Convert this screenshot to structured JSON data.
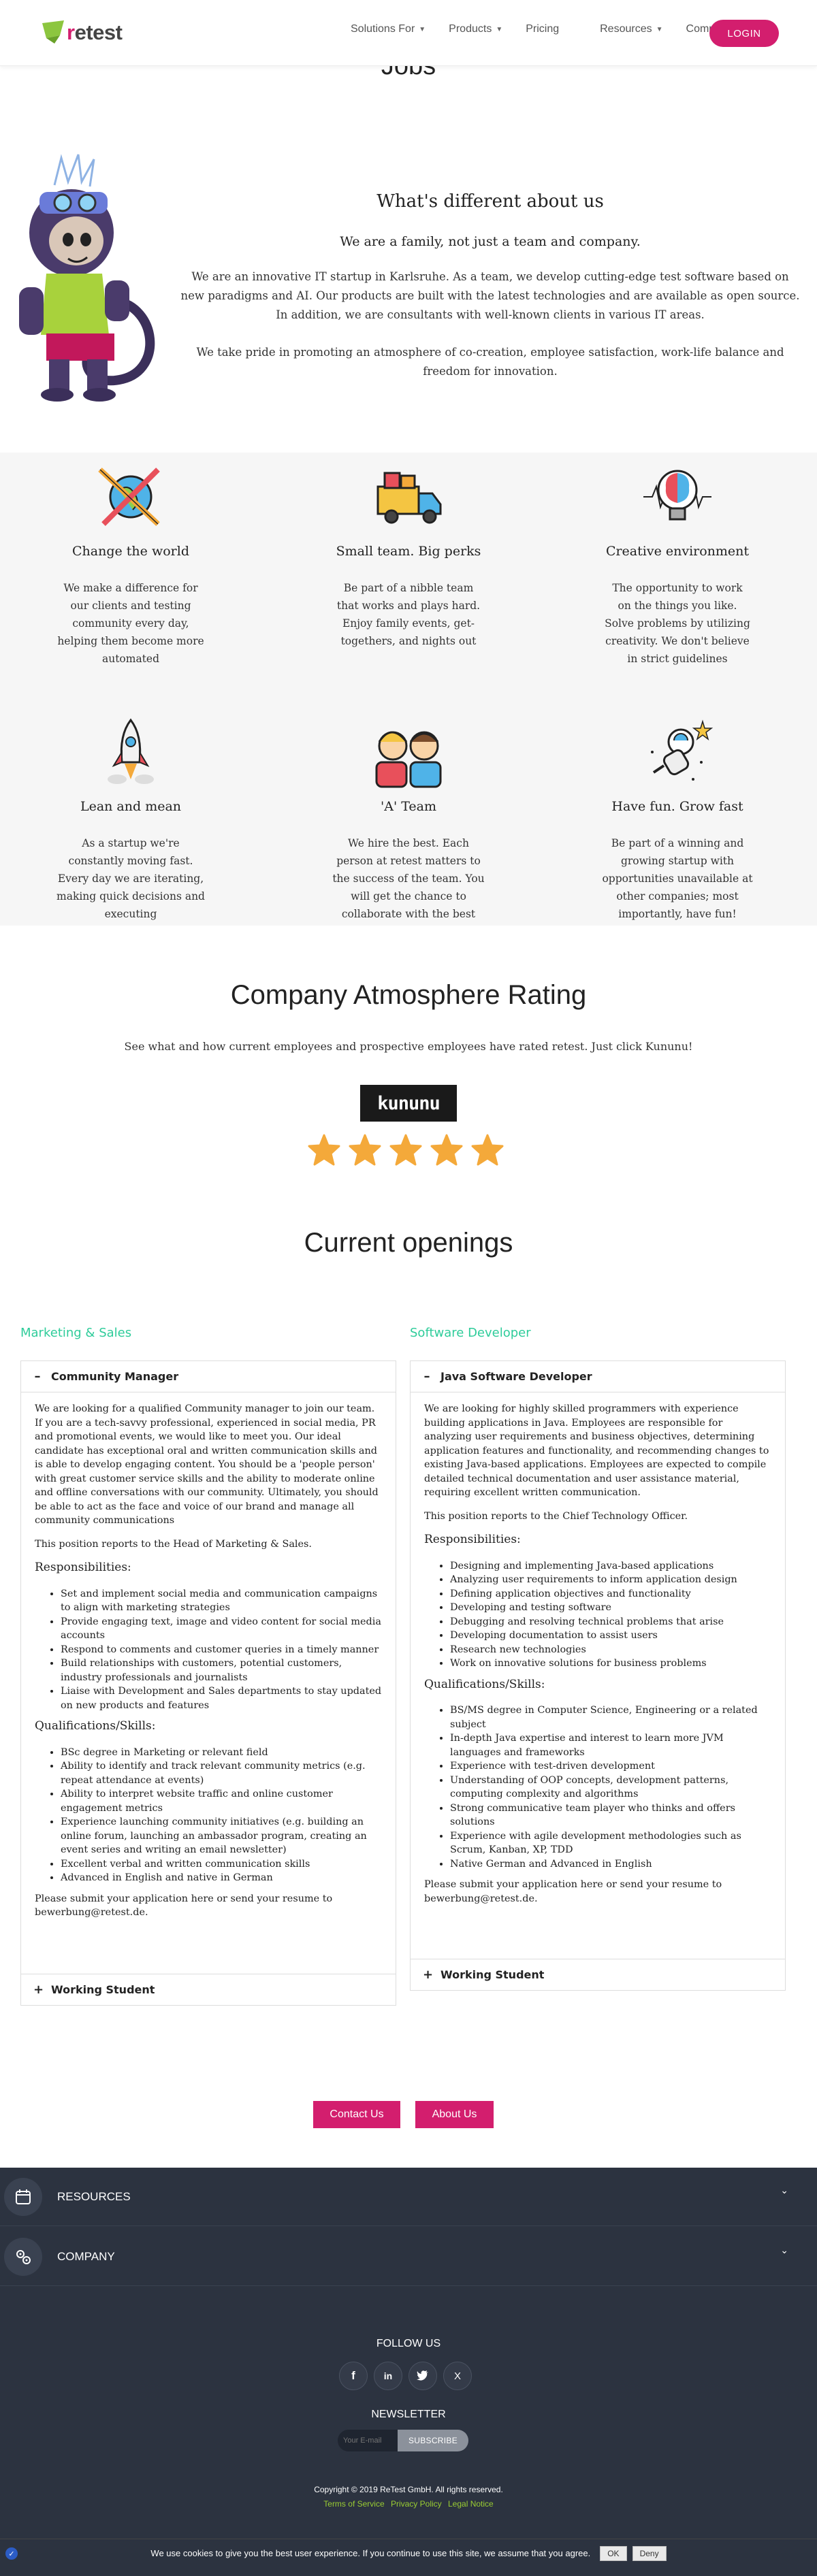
{
  "header": {
    "logo_text_r": "r",
    "logo_text_rest": "etest",
    "nav": [
      {
        "label": "Solutions For",
        "dropdown": true
      },
      {
        "label": "Products",
        "dropdown": true
      },
      {
        "label": "Pricing",
        "dropdown": false
      },
      {
        "label": "Resources",
        "dropdown": true
      },
      {
        "label": "Company",
        "dropdown": true
      }
    ],
    "login_label": "LOGIN"
  },
  "intro": {
    "jobs_title": "Jobs",
    "about_heading": "What's different about us",
    "about_sub": "We are a family, not just a team and company.",
    "about_p1": "We are an innovative IT startup in Karlsruhe. As a team, we develop cutting-edge test software based on new paradigms and AI. Our products are built with the latest technologies and are available as open source. In addition, we are consultants with well-known clients in various IT areas.",
    "about_p2": "We take pride in promoting an atmosphere of co-creation, employee satisfaction, work-life balance and freedom for innovation."
  },
  "features": [
    {
      "icon": "globe-pencils-icon",
      "title": "Change the world",
      "text": "We make a difference for our clients and testing community every day, helping them become more automated"
    },
    {
      "icon": "truck-icon",
      "title": "Small team. Big perks",
      "text": "Be part of a nibble team that works and plays hard. Enjoy family events, get-togethers, and nights out"
    },
    {
      "icon": "lightbulb-brain-icon",
      "title": "Creative environment",
      "text": "The opportunity to work on the things you like. Solve problems by utilizing creativity. We don't believe in strict guidelines"
    },
    {
      "icon": "rocket-icon",
      "title": "Lean and mean",
      "text": "As a startup we're constantly moving fast. Every day we are iterating, making quick decisions and executing"
    },
    {
      "icon": "team-people-icon",
      "title": "'A' Team",
      "text": "We hire the best. Each person at retest matters to the success of the team. You will get the chance to collaborate with the best"
    },
    {
      "icon": "astronaut-icon",
      "title": "Have fun. Grow fast",
      "text": "Be part of a winning and growing startup with opportunities unavailable at other companies; most importantly, have fun!"
    }
  ],
  "rating": {
    "heading": "Company Atmosphere Rating",
    "text": "See what and how current employees and prospective employees have rated retest. Just click Kununu!",
    "kununu_label": "kununu",
    "stars": 5,
    "star_color": "#f4a93a"
  },
  "openings": {
    "heading": "Current openings",
    "columns": [
      {
        "title": "Marketing & Sales",
        "open_job": {
          "title": "Community Manager",
          "intro": "We are looking for a qualified Community manager to join our team. If you are a tech-savvy professional, experienced in social media, PR and promotional events, we would like to meet you. Our ideal candidate has exceptional oral and written communication skills and is able to develop engaging content. You should be a 'people person' with great customer service skills and the ability to moderate online and offline conversations with our community. Ultimately, you should be able to act as the face and voice of our brand and manage all community communications",
          "reports": "This position reports to the Head of Marketing & Sales.",
          "resp_heading": "Responsibilities:",
          "responsibilities": [
            "Set and implement social media and communication campaigns to align with marketing strategies",
            "Provide engaging text, image and video content for social media accounts",
            "Respond to comments and customer queries in a timely manner",
            "Build relationships with customers, potential customers, industry professionals and journalists",
            "Liaise with Development and Sales departments to stay updated on new products and features"
          ],
          "qual_heading": "Qualifications/Skills:",
          "qualifications": [
            "BSc degree in Marketing or relevant field",
            "Ability to identify and track relevant community metrics (e.g. repeat attendance at events)",
            "Ability to interpret website traffic and online customer engagement metrics",
            "Experience launching community initiatives (e.g. building an online forum, launching an ambassador program, creating an event series and writing an email newsletter)",
            "Excellent verbal and written communication skills",
            "Advanced in English and native in German"
          ],
          "apply": "Please submit your application here or send your resume to bewerbung@retest.de."
        },
        "closed_job": "Working Student"
      },
      {
        "title": "Software Developer",
        "open_job": {
          "title": "Java Software Developer",
          "intro": "We are looking for highly skilled programmers with experience building applications in Java. Employees are responsible for analyzing user requirements and business objectives, determining application features and functionality, and recommending changes to existing Java-based applications. Employees are expected to compile detailed technical documentation and user assistance material, requiring excellent written communication.",
          "reports": "This position reports to the Chief Technology Officer.",
          "resp_heading": "Responsibilities:",
          "responsibilities": [
            "Designing and implementing Java-based applications",
            "Analyzing user requirements to inform application design",
            "Defining application objectives and functionality",
            "Developing and testing software",
            "Debugging and resolving technical problems that arise",
            "Developing documentation to assist users",
            "Research new technologies",
            "Work on innovative solutions for business problems"
          ],
          "qual_heading": "Qualifications/Skills:",
          "qualifications": [
            "BS/MS degree in Computer Science, Engineering or a related subject",
            "In-depth Java expertise and interest to learn more JVM languages and frameworks",
            "Experience with test-driven development",
            "Understanding of OOP concepts, development patterns, computing complexity and algorithms",
            "Strong communicative team player who thinks and offers solutions",
            "Experience with agile development methodologies such as Scrum, Kanban, XP, TDD",
            "Native German and Advanced in English"
          ],
          "apply": "Please submit your application here or send your resume to bewerbung@retest.de."
        },
        "closed_job": "Working Student"
      }
    ],
    "contact_label": "Contact Us",
    "about_label": "About Us"
  },
  "footer": {
    "sections": [
      "RESOURCES",
      "COMPANY"
    ],
    "follow": "FOLLOW US",
    "socials": [
      "f",
      "in",
      "t",
      "X"
    ],
    "newsletter": "NEWSLETTER",
    "email_placeholder": "Your E-mail",
    "subscribe": "SUBSCRIBE",
    "copyright": "Copyright © 2019 ReTest GmbH. All rights reserved.",
    "links": [
      "Terms of Service",
      "Privacy Policy",
      "Legal Notice"
    ]
  },
  "cookie": {
    "text": "We use cookies to give you the best user experience. If you continue to use this site, we assume that you agree.",
    "ok": "OK",
    "deny": "Deny"
  },
  "colors": {
    "brand": "#d31e6e",
    "accent_green": "#2ecc9a",
    "footer_bg": "#2c3340"
  }
}
